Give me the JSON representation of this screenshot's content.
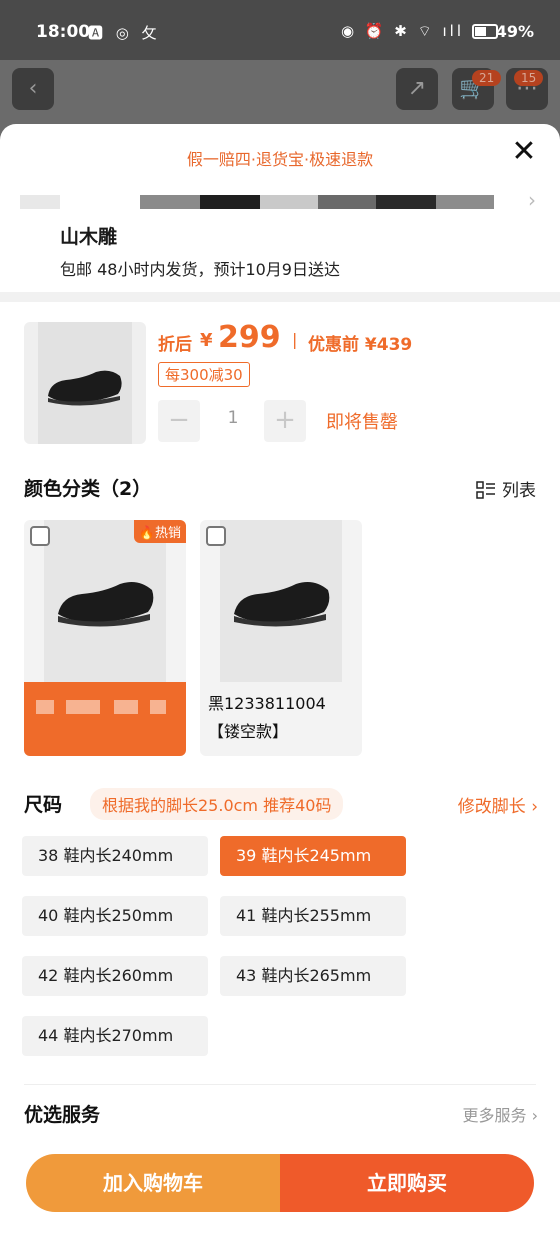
{
  "status_bar": {
    "time": "18:00",
    "left_icons": "🅰 ◎ 攵",
    "right_icons": "◉ ⏰ ✱ ⌔ ıll",
    "battery": "49%"
  },
  "background": {
    "back_icon": "‹",
    "share_icon": "↗",
    "cart_badge": "21",
    "more_badge": "15"
  },
  "sheet": {
    "guarantee": "假一赔四·退货宝·极速退款",
    "close_icon": "✕",
    "shop_name": "山木雕",
    "shipping": "包邮 48小时内发货，预计10月9日送达"
  },
  "price": {
    "after_label": "折后",
    "yen": "¥",
    "value": "299",
    "separator": "|",
    "orig_label": "优惠前 ¥439",
    "coupon": "每300减30"
  },
  "stepper": {
    "minus": "−",
    "value": "1",
    "plus": "+",
    "status": "即将售罄"
  },
  "colors": {
    "title": "颜色分类（2）",
    "view_label": "列表",
    "items": [
      {
        "badge": "🔥热销",
        "caption": ""
      },
      {
        "caption_line1": "黑1233811004",
        "caption_line2": "【镂空款】"
      }
    ]
  },
  "size": {
    "title": "尺码",
    "recommend": "根据我的脚长25.0cm 推荐40码",
    "modify": "修改脚长 ›",
    "options": [
      "38 鞋内长240mm",
      "39 鞋内长245mm",
      "40 鞋内长250mm",
      "41 鞋内长255mm",
      "42 鞋内长260mm",
      "43 鞋内长265mm",
      "44 鞋内长270mm"
    ]
  },
  "service": {
    "title": "优选服务",
    "more": "更多服务 ›"
  },
  "actions": {
    "add_to_cart": "加入购物车",
    "buy_now": "立即购买"
  },
  "colors_palette": {
    "accent": "#ef6b2a",
    "cart_button": "#f09a3b",
    "buy_button": "#ef5a2a"
  }
}
